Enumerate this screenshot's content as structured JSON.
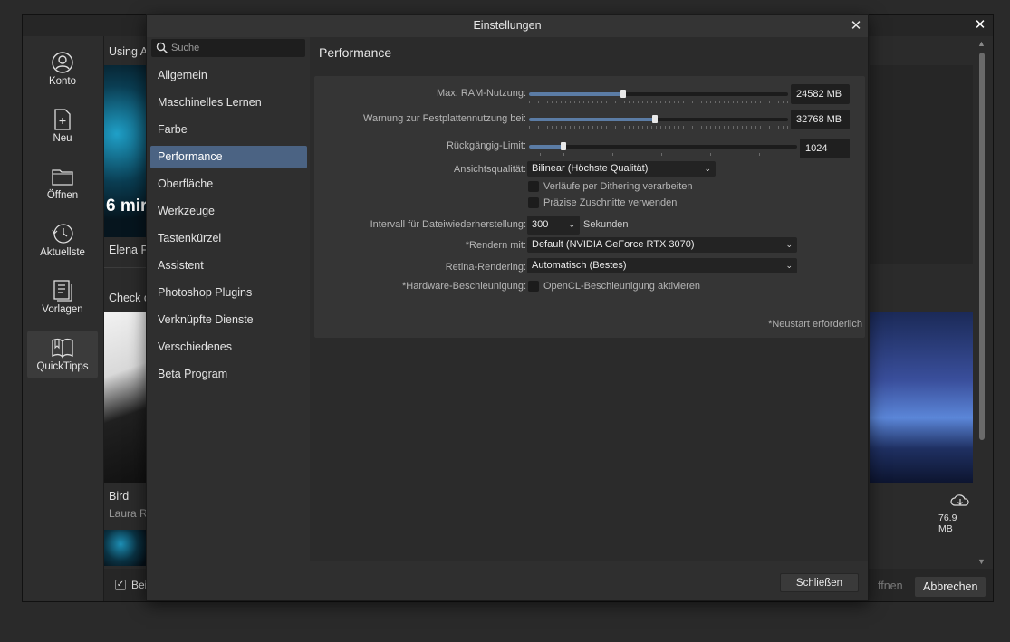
{
  "background_window": {
    "sidebar": [
      {
        "label": "Konto",
        "icon": "account-icon"
      },
      {
        "label": "Neu",
        "icon": "new-document-icon"
      },
      {
        "label": "Öffnen",
        "icon": "folder-icon"
      },
      {
        "label": "Aktuellste",
        "icon": "recent-icon"
      },
      {
        "label": "Vorlagen",
        "icon": "templates-icon"
      },
      {
        "label": "QuickTipps",
        "icon": "book-icon"
      }
    ],
    "cards": {
      "section1_title": "Using A",
      "overlay_text": "6 mir",
      "card1_author": "Elena Pa",
      "section2_title": "Check o",
      "card2_title": "Bird",
      "card2_author": "Laura R",
      "download_size": "76.9 MB"
    },
    "footer": {
      "checkbox_label": "Bei",
      "open_label": "ffnen",
      "cancel_label": "Abbrechen"
    }
  },
  "dialog": {
    "title": "Einstellungen",
    "search_placeholder": "Suche",
    "nav": [
      "Allgemein",
      "Maschinelles Lernen",
      "Farbe",
      "Performance",
      "Oberfläche",
      "Werkzeuge",
      "Tastenkürzel",
      "Assistent",
      "Photoshop Plugins",
      "Verknüpfte Dienste",
      "Verschiedenes",
      "Beta Program"
    ],
    "active_nav": "Performance",
    "section_title": "Performance",
    "settings": {
      "ram_label": "Max. RAM-Nutzung:",
      "ram_value": "24582 MB",
      "ram_fraction": 0.365,
      "disk_label": "Warnung zur Festplattennutzung bei:",
      "disk_value": "32768 MB",
      "disk_fraction": 0.487,
      "undo_label": "Rückgängig-Limit:",
      "undo_value": "1024",
      "undo_fraction": 0.127,
      "view_quality_label": "Ansichtsqualität:",
      "view_quality_value": "Bilinear (Höchste Qualität)",
      "dither_label": "Verläufe per Dithering verarbeiten",
      "dither_checked": false,
      "precise_label": "Präzise Zuschnitte verwenden",
      "precise_checked": false,
      "recovery_label": "Intervall für Dateiwiederherstellung:",
      "recovery_value": "300",
      "recovery_unit": "Sekunden",
      "render_label": "*Rendern mit:",
      "render_value": "Default (NVIDIA GeForce RTX 3070)",
      "retina_label": "Retina-Rendering:",
      "retina_value": "Automatisch (Bestes)",
      "hw_label": "*Hardware-Beschleunigung:",
      "hw_check_label": "OpenCL-Beschleunigung aktivieren",
      "hw_checked": false,
      "restart_note": "*Neustart erforderlich"
    },
    "close_button": "Schließen"
  },
  "colors": {
    "accent": "#4b6383",
    "slider_fill": "#5b7ca5"
  }
}
